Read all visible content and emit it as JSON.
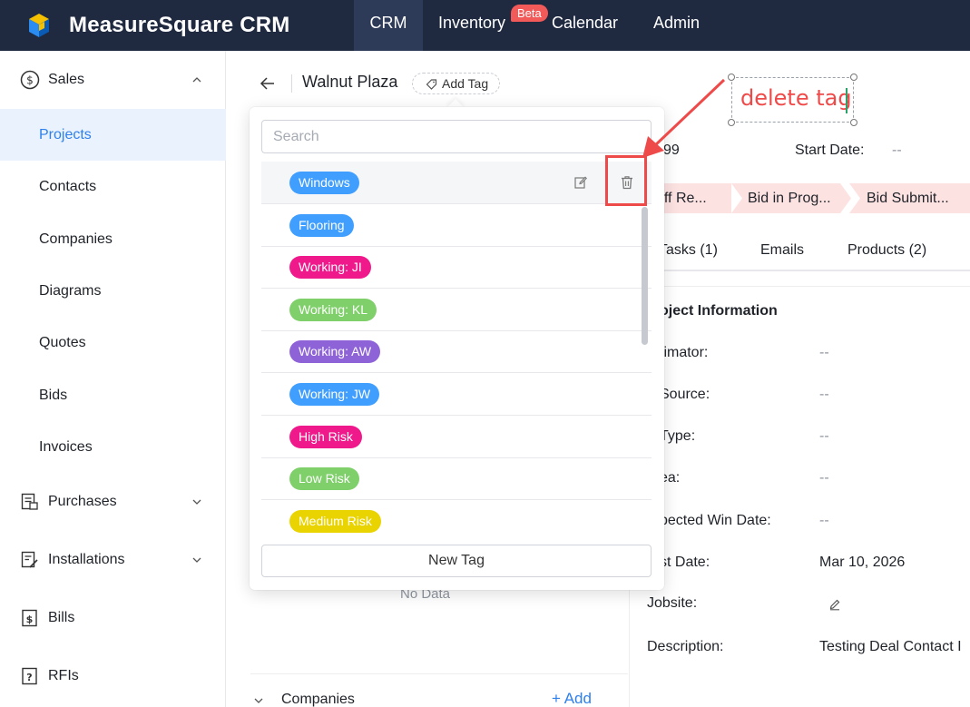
{
  "app": {
    "brand": "MeasureSquare CRM"
  },
  "topnav": {
    "items": [
      {
        "id": "crm",
        "label": "CRM",
        "active": true
      },
      {
        "id": "inventory",
        "label": "Inventory",
        "badge": "Beta"
      },
      {
        "id": "calendar",
        "label": "Calendar"
      },
      {
        "id": "admin",
        "label": "Admin"
      }
    ]
  },
  "sidebar": {
    "sales": "Sales",
    "items": [
      "Projects",
      "Contacts",
      "Companies",
      "Diagrams",
      "Quotes",
      "Bids",
      "Invoices"
    ],
    "purchases": "Purchases",
    "installations": "Installations",
    "bills": "Bills",
    "rfis": "RFIs"
  },
  "header": {
    "title": "Walnut Plaza",
    "add_tag": "Add Tag"
  },
  "tag_dropdown": {
    "search_placeholder": "Search",
    "tags": [
      {
        "label": "Windows",
        "color": "#409eff"
      },
      {
        "label": "Flooring",
        "color": "#409eff"
      },
      {
        "label": "Working: JI",
        "color": "#f0198b"
      },
      {
        "label": "Working: KL",
        "color": "#7fcf6a"
      },
      {
        "label": "Working: AW",
        "color": "#8e63d8"
      },
      {
        "label": "Working: JW",
        "color": "#409eff"
      },
      {
        "label": "High Risk",
        "color": "#f0198b"
      },
      {
        "label": "Low Risk",
        "color": "#7fcf6a"
      },
      {
        "label": "Medium Risk",
        "color": "#e9d300"
      }
    ],
    "new_tag": "New Tag"
  },
  "left_panel": {
    "no_data": "No Data",
    "companies": "Companies",
    "add": "+ Add"
  },
  "details": {
    "id_partial": "99",
    "start_date_label": "Start Date:",
    "start_date_value": "--",
    "stages": [
      "off Re...",
      "Bid in Prog...",
      "Bid Submit..."
    ],
    "tabs": [
      "Tasks (1)",
      "Emails",
      "Products (2)"
    ],
    "section_title": "oject Information",
    "fields": [
      {
        "label": "timator:",
        "value": "--"
      },
      {
        "label": "Source:",
        "value": "--"
      },
      {
        "label": "Type:",
        "value": "--"
      },
      {
        "label": "ea:",
        "value": "--"
      },
      {
        "label": "pected Win Date:",
        "value": "--"
      },
      {
        "label": "st Date:",
        "value": "Mar 10, 2026"
      },
      {
        "label": "Jobsite:",
        "value": ""
      },
      {
        "label": "Description:",
        "value": "Testing Deal Contact I"
      }
    ]
  },
  "annotation": {
    "text": "delete tag",
    "color": "#ef4a4a"
  }
}
